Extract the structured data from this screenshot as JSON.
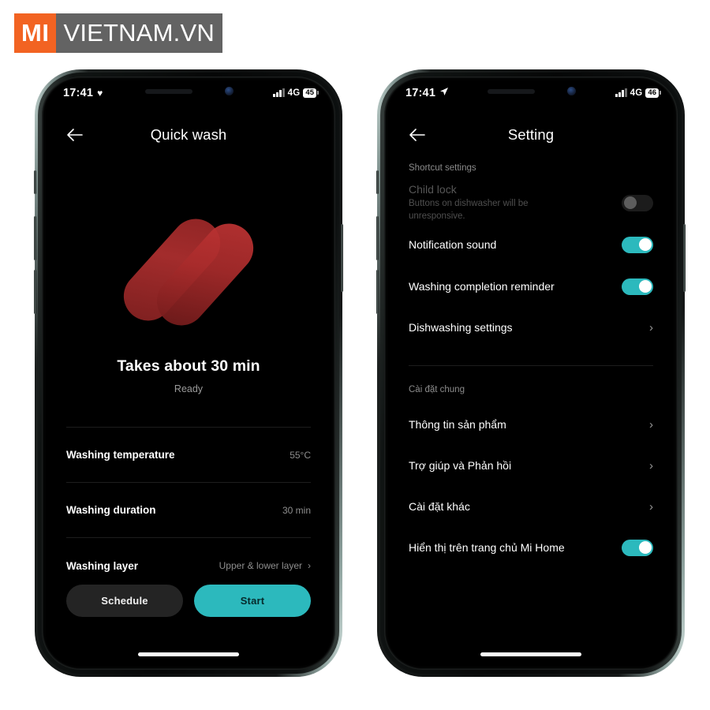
{
  "watermark": {
    "brand": "MI",
    "domain": "VIETNAM.VN",
    "brand_color": "#f26322",
    "domain_bg": "#636363"
  },
  "theme": {
    "accent": "#2cb9bd",
    "screen_bg": "#000000",
    "divider": "#1d1d1d"
  },
  "phone_left": {
    "status": {
      "time": "17:41",
      "left_icon": "heart-icon",
      "network": "4G",
      "battery": "45"
    },
    "header": {
      "back_icon": "back-arrow-icon",
      "title": "Quick wash"
    },
    "hero": {
      "logo_icon": "lightning-bolt-logo",
      "primary_text": "Takes about 30 min",
      "status_text": "Ready"
    },
    "rows": [
      {
        "label": "Washing temperature",
        "value": "55°C",
        "chevron": false
      },
      {
        "label": "Washing duration",
        "value": "30 min",
        "chevron": false
      },
      {
        "label": "Washing layer",
        "value": "Upper & lower layer",
        "chevron": true
      }
    ],
    "buttons": {
      "secondary": "Schedule",
      "primary": "Start"
    }
  },
  "phone_right": {
    "status": {
      "time": "17:41",
      "left_icon": "location-arrow-icon",
      "network": "4G",
      "battery": "46"
    },
    "header": {
      "back_icon": "back-arrow-icon",
      "title": "Setting"
    },
    "section_1": {
      "title": "Shortcut settings",
      "rows": [
        {
          "title": "Child lock",
          "subtitle": "Buttons on dishwasher will be unresponsive.",
          "control": "toggle",
          "state": "off",
          "disabled": true
        },
        {
          "title": "Notification sound",
          "subtitle": "",
          "control": "toggle",
          "state": "on",
          "disabled": false
        },
        {
          "title": "Washing completion reminder",
          "subtitle": "",
          "control": "toggle",
          "state": "on",
          "disabled": false
        },
        {
          "title": "Dishwashing settings",
          "subtitle": "",
          "control": "chevron",
          "state": "",
          "disabled": false
        }
      ]
    },
    "section_2": {
      "title": "Cài đặt chung",
      "rows": [
        {
          "title": "Thông tin sản phẩm",
          "control": "chevron",
          "state": ""
        },
        {
          "title": "Trợ giúp và Phản hồi",
          "control": "chevron",
          "state": ""
        },
        {
          "title": "Cài đặt khác",
          "control": "chevron",
          "state": ""
        },
        {
          "title": "Hiển thị trên trang chủ Mi Home",
          "control": "toggle",
          "state": "on"
        }
      ]
    }
  },
  "glyphs": {
    "chevron_right": "›",
    "heart": "♥"
  }
}
